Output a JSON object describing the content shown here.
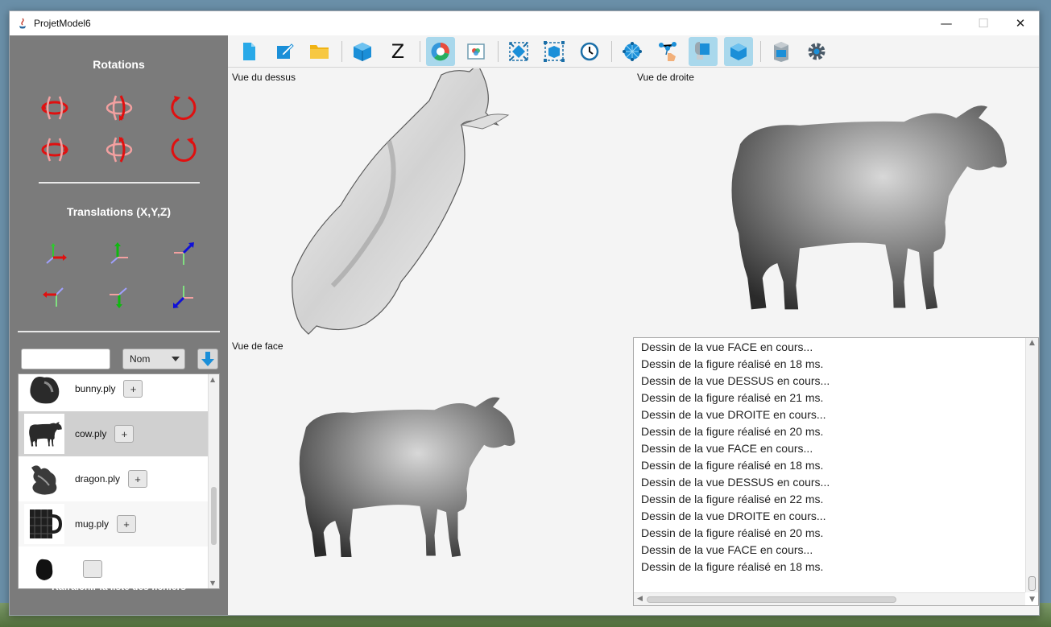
{
  "window": {
    "title": "ProjetModel6",
    "controls": {
      "minimize": "—",
      "maximize": "☐",
      "close": "✕"
    }
  },
  "sidebar": {
    "rotations_title": "Rotations",
    "translations_title": "Translations (X,Y,Z)",
    "rotation_buttons": [
      "rotate-x-pos",
      "rotate-y-pos",
      "rotate-z-pos",
      "rotate-x-neg",
      "rotate-y-neg",
      "rotate-z-neg"
    ],
    "translation_buttons": [
      "translate-x-pos",
      "translate-y-pos",
      "translate-z-pos",
      "translate-x-neg",
      "translate-y-neg",
      "translate-z-neg"
    ],
    "filter": {
      "value": "",
      "placeholder": ""
    },
    "sort": {
      "selected": "Nom"
    },
    "files": [
      {
        "name": "bunny.ply",
        "add_label": "+"
      },
      {
        "name": "cow.ply",
        "add_label": "+",
        "selected": true
      },
      {
        "name": "dragon.ply",
        "add_label": "+"
      },
      {
        "name": "mug.ply",
        "add_label": "+"
      },
      {
        "name": "",
        "add_label": ""
      }
    ],
    "refresh_label": "Rafraichir la liste des fichiers"
  },
  "toolbar": {
    "buttons": [
      {
        "icon": "new-file-icon"
      },
      {
        "icon": "edit-icon"
      },
      {
        "icon": "open-folder-icon"
      },
      {
        "icon": "model-cube-icon"
      },
      {
        "icon": "z-axis-icon",
        "label": "Z"
      },
      {
        "icon": "color-wheel-icon",
        "active": true
      },
      {
        "icon": "palette-icon"
      },
      {
        "icon": "center-icon"
      },
      {
        "icon": "fit-icon"
      },
      {
        "icon": "clock-icon"
      },
      {
        "icon": "mesh-icon"
      },
      {
        "icon": "points-icon"
      },
      {
        "icon": "lighting-icon",
        "active": true
      },
      {
        "icon": "solid-cube-icon",
        "active": true
      },
      {
        "icon": "layers-icon"
      },
      {
        "icon": "settings-icon"
      }
    ]
  },
  "views": {
    "top": "Vue du dessus",
    "right": "Vue de droite",
    "front": "Vue de face"
  },
  "console": {
    "lines": [
      "Dessin de la vue FACE en cours...",
      "Dessin de la figure réalisé en 18 ms.",
      "Dessin de la vue DESSUS en cours...",
      "Dessin de la figure réalisé en 21 ms.",
      "Dessin de la vue DROITE en cours...",
      "Dessin de la figure réalisé en 20 ms.",
      "Dessin de la vue FACE en cours...",
      "Dessin de la figure réalisé en 18 ms.",
      "Dessin de la vue DESSUS en cours...",
      "Dessin de la figure réalisé en 22 ms.",
      "Dessin de la vue DROITE en cours...",
      "Dessin de la figure réalisé en 20 ms.",
      "Dessin de la vue FACE en cours...",
      "Dessin de la figure réalisé en 18 ms."
    ]
  }
}
